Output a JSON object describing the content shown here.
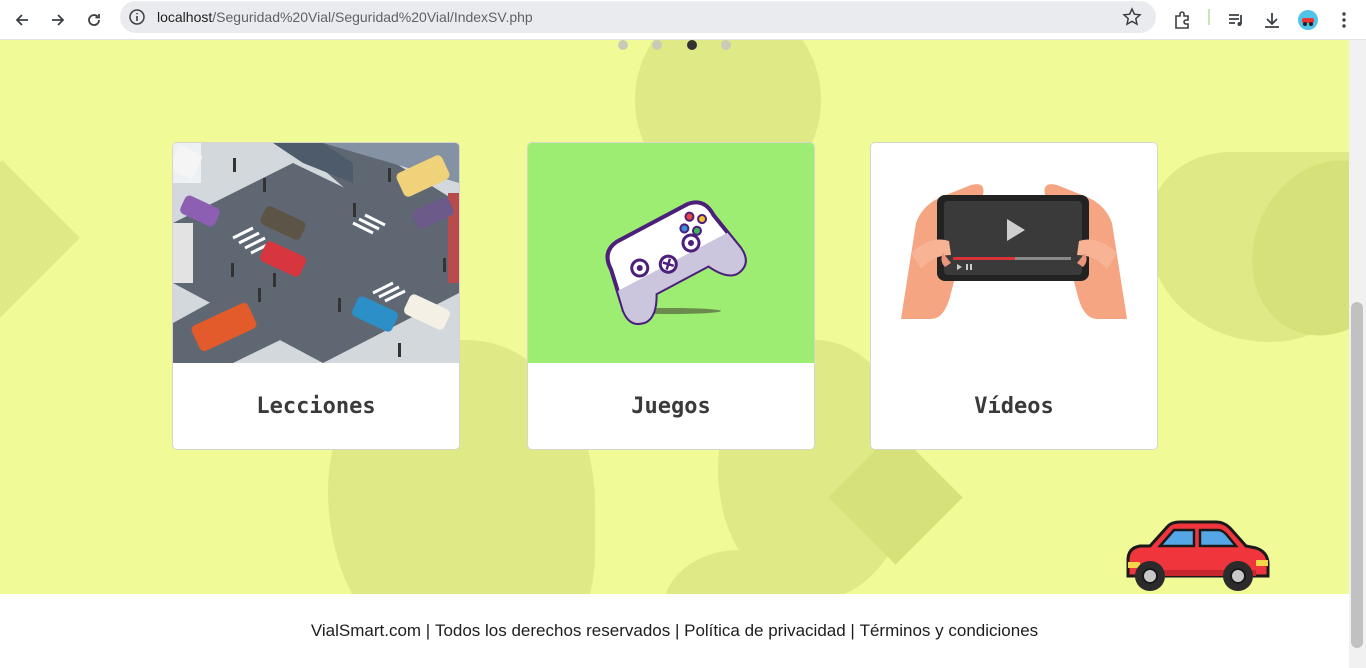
{
  "browser": {
    "url_host": "localhost",
    "url_path": "/Seguridad%20Vial/Seguridad%20Vial/IndexSV.php",
    "icons": [
      "back-arrow-icon",
      "forward-arrow-icon",
      "reload-icon",
      "info-icon",
      "star-icon",
      "extensions-icon",
      "media-icon",
      "download-icon",
      "profile-avatar",
      "more-menu-icon"
    ]
  },
  "carousel": {
    "dots": 4,
    "active_index": 2
  },
  "cards": [
    {
      "title": "Lecciones",
      "image": "city-intersection-illustration"
    },
    {
      "title": "Juegos",
      "image": "gamepad-illustration"
    },
    {
      "title": "Vídeos",
      "image": "phone-video-illustration"
    }
  ],
  "footer": {
    "site": "VialSmart.com",
    "rights": "Todos los derechos reservados",
    "privacy": "Política de privacidad",
    "terms": "Términos y condiciones",
    "separator": " | "
  },
  "colors": {
    "page_bg": "#f0fb97",
    "blob": "#dfe985",
    "juegos_bg": "#9ced71",
    "car_red": "#f0353c"
  }
}
